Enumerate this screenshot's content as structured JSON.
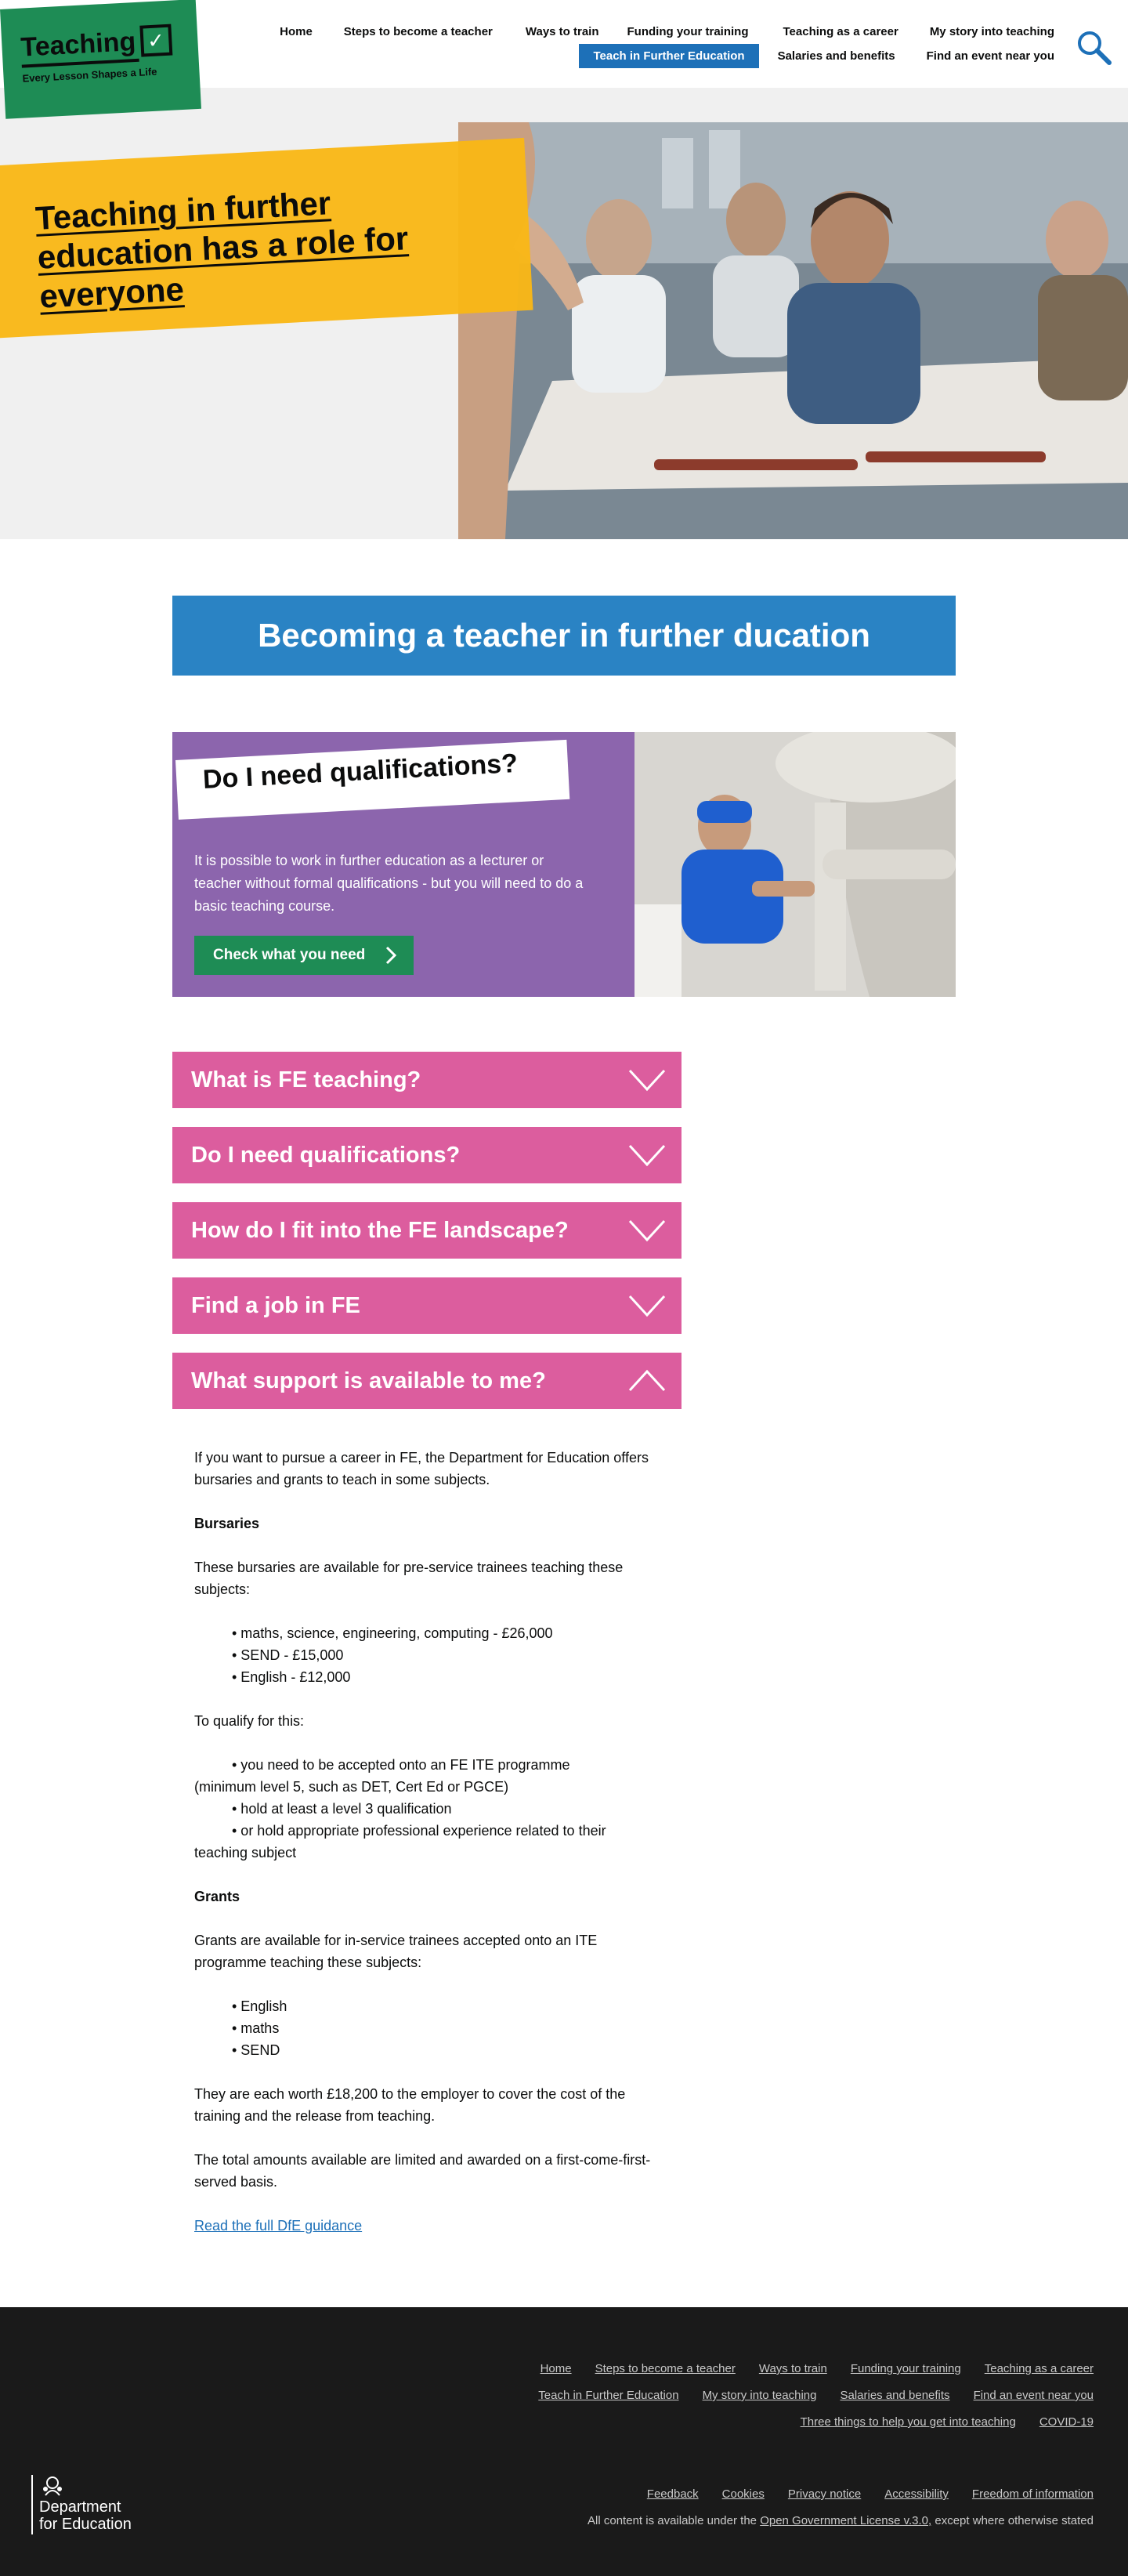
{
  "header": {
    "logo": {
      "word": "Teaching",
      "tagline": "Every Lesson Shapes a Life",
      "brand_color": "#1e8c55"
    },
    "nav_row1": [
      "Home",
      "Steps to become a teacher",
      "Ways to train",
      "Funding your training",
      "Teaching as a career",
      "My story into teaching"
    ],
    "nav_row2": [
      "Teach in Further Education",
      "Salaries and benefits",
      "Find an event near you"
    ],
    "active_nav": "Teach in Further Education",
    "search_icon": "search-icon"
  },
  "hero": {
    "title": "Teaching in further education has a role for everyone",
    "banner_color": "#f9b716"
  },
  "main": {
    "section_title": "Becoming a teacher in further ducation",
    "qualification_card": {
      "label": "Do I need qualifications?",
      "text": "It is possible to work in further education as a lecturer or teacher without formal qualifications - but you will need to do a basic teaching course.",
      "button": "Check what you need",
      "card_color": "#8c65ad"
    },
    "accordions": [
      {
        "title": "What is FE teaching?",
        "state": "collapsed"
      },
      {
        "title": "Do I need qualifications?",
        "state": "collapsed"
      },
      {
        "title": "How do I fit into the FE landscape?",
        "state": "collapsed"
      },
      {
        "title": "Find a job in FE",
        "state": "collapsed"
      },
      {
        "title": "What support is available to me?",
        "state": "expanded"
      }
    ],
    "accordion_color": "#dc5d9e",
    "support_content": {
      "intro": "If you want to pursue a career in FE, the Department for Education offers  bursaries and grants to teach in some subjects.",
      "bursaries_heading": "Bursaries",
      "bursaries_intro": "These bursaries are available for pre-service trainees teaching these subjects:",
      "bursaries_list": [
        "• maths, science, engineering, computing - £26,000",
        "• SEND - £15,000",
        "• English - £12,000"
      ],
      "qualify_intro": "To qualify for this:",
      "qualify_list": [
        "• you need to be accepted onto an FE ITE programme",
        "(minimum level 5, such as DET, Cert Ed or PGCE)",
        "• hold at least a level 3 qualification",
        "• or hold appropriate professional experience related to their",
        "teaching subject"
      ],
      "grants_heading": "Grants",
      "grants_intro": "Grants are available for in-service trainees accepted onto an ITE programme teaching these subjects:",
      "grants_list": [
        "• English",
        "• maths",
        "• SEND"
      ],
      "worth": "They are each worth £18,200 to the employer to cover the cost of the training and the release from teaching.",
      "limited": "The total amounts available are limited and awarded on a first-come-first-served basis.",
      "guidance_link": "Read the full DfE guidance"
    }
  },
  "footer": {
    "links_row1": [
      "Home",
      "Steps to become a teacher",
      "Ways to train",
      "Funding your training",
      "Teaching as a career"
    ],
    "links_row2": [
      "Teach in Further Education",
      "My story into teaching",
      "Salaries and benefits",
      "Find an event near you"
    ],
    "links_row3": [
      "Three things to help you get into teaching",
      "COVID-19"
    ],
    "legal_links": [
      "Feedback",
      "Cookies",
      "Privacy notice",
      "Accessibility",
      "Freedom of information"
    ],
    "license_prefix": "All content is available under the",
    "license_link": "Open Government License v.3.0,",
    "license_suffix": "except where otherwise stated",
    "dfe_name": [
      "Department",
      "for Education"
    ],
    "background": "#1a1a1a"
  }
}
